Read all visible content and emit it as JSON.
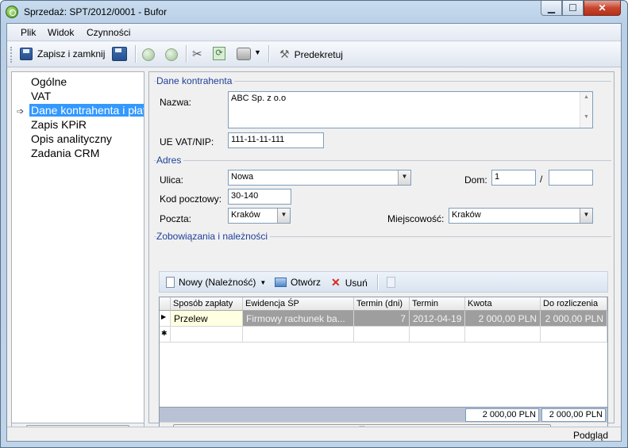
{
  "window": {
    "title": "Sprzedaż: SPT/2012/0001 - Bufor",
    "minimize": "▁",
    "maximize": "☐",
    "close": "✕"
  },
  "menu": {
    "items": [
      "Plik",
      "Widok",
      "Czynności"
    ]
  },
  "toolbar": {
    "save_close_label": "Zapisz i zamknij",
    "predecree_label": "Predekretuj"
  },
  "nav": {
    "items": [
      "Ogólne",
      "VAT",
      "Dane kontrahenta i płatności",
      "Zapis KPiR",
      "Opis analityczny",
      "Zadania CRM"
    ],
    "selected_index": 2
  },
  "sections": {
    "contractor": "Dane kontrahenta",
    "address": "Adres",
    "obligations": "Zobowiązania i należności"
  },
  "contractor": {
    "name_label": "Nazwa:",
    "name_value": "ABC Sp. z o.o",
    "vat_label": "UE VAT/NIP:",
    "vat_value": "111-11-11-111"
  },
  "address": {
    "street_label": "Ulica:",
    "street_value": "Nowa",
    "house_label": "Dom:",
    "house_value": "1",
    "flat_sep": "/",
    "flat_value": "",
    "postcode_label": "Kod pocztowy:",
    "postcode_value": "30-140",
    "post_label": "Poczta:",
    "post_value": "Kraków",
    "city_label": "Miejscowość:",
    "city_value": "Kraków"
  },
  "grid_toolbar": {
    "new_label": "Nowy (Należność)",
    "open_label": "Otwórz",
    "delete_label": "Usuń"
  },
  "grid": {
    "columns": [
      "Sposób zapłaty",
      "Ewidencja ŚP",
      "Termin (dni)",
      "Termin",
      "Kwota",
      "Do rozliczenia"
    ],
    "rows": [
      [
        "Przelew",
        "Firmowy rachunek ba...",
        "7",
        "2012-04-19",
        "2 000,00 PLN",
        "2 000,00 PLN"
      ]
    ],
    "totals": [
      "2 000,00 PLN",
      "2 000,00 PLN"
    ],
    "scroll_thumb": "III",
    "new_row_marker": "✱"
  },
  "status": {
    "text": "Podgląd"
  },
  "colors": {
    "selection": "#3399ff",
    "section_title": "#1f3f9a",
    "row_gray": "#9e9e9e"
  }
}
